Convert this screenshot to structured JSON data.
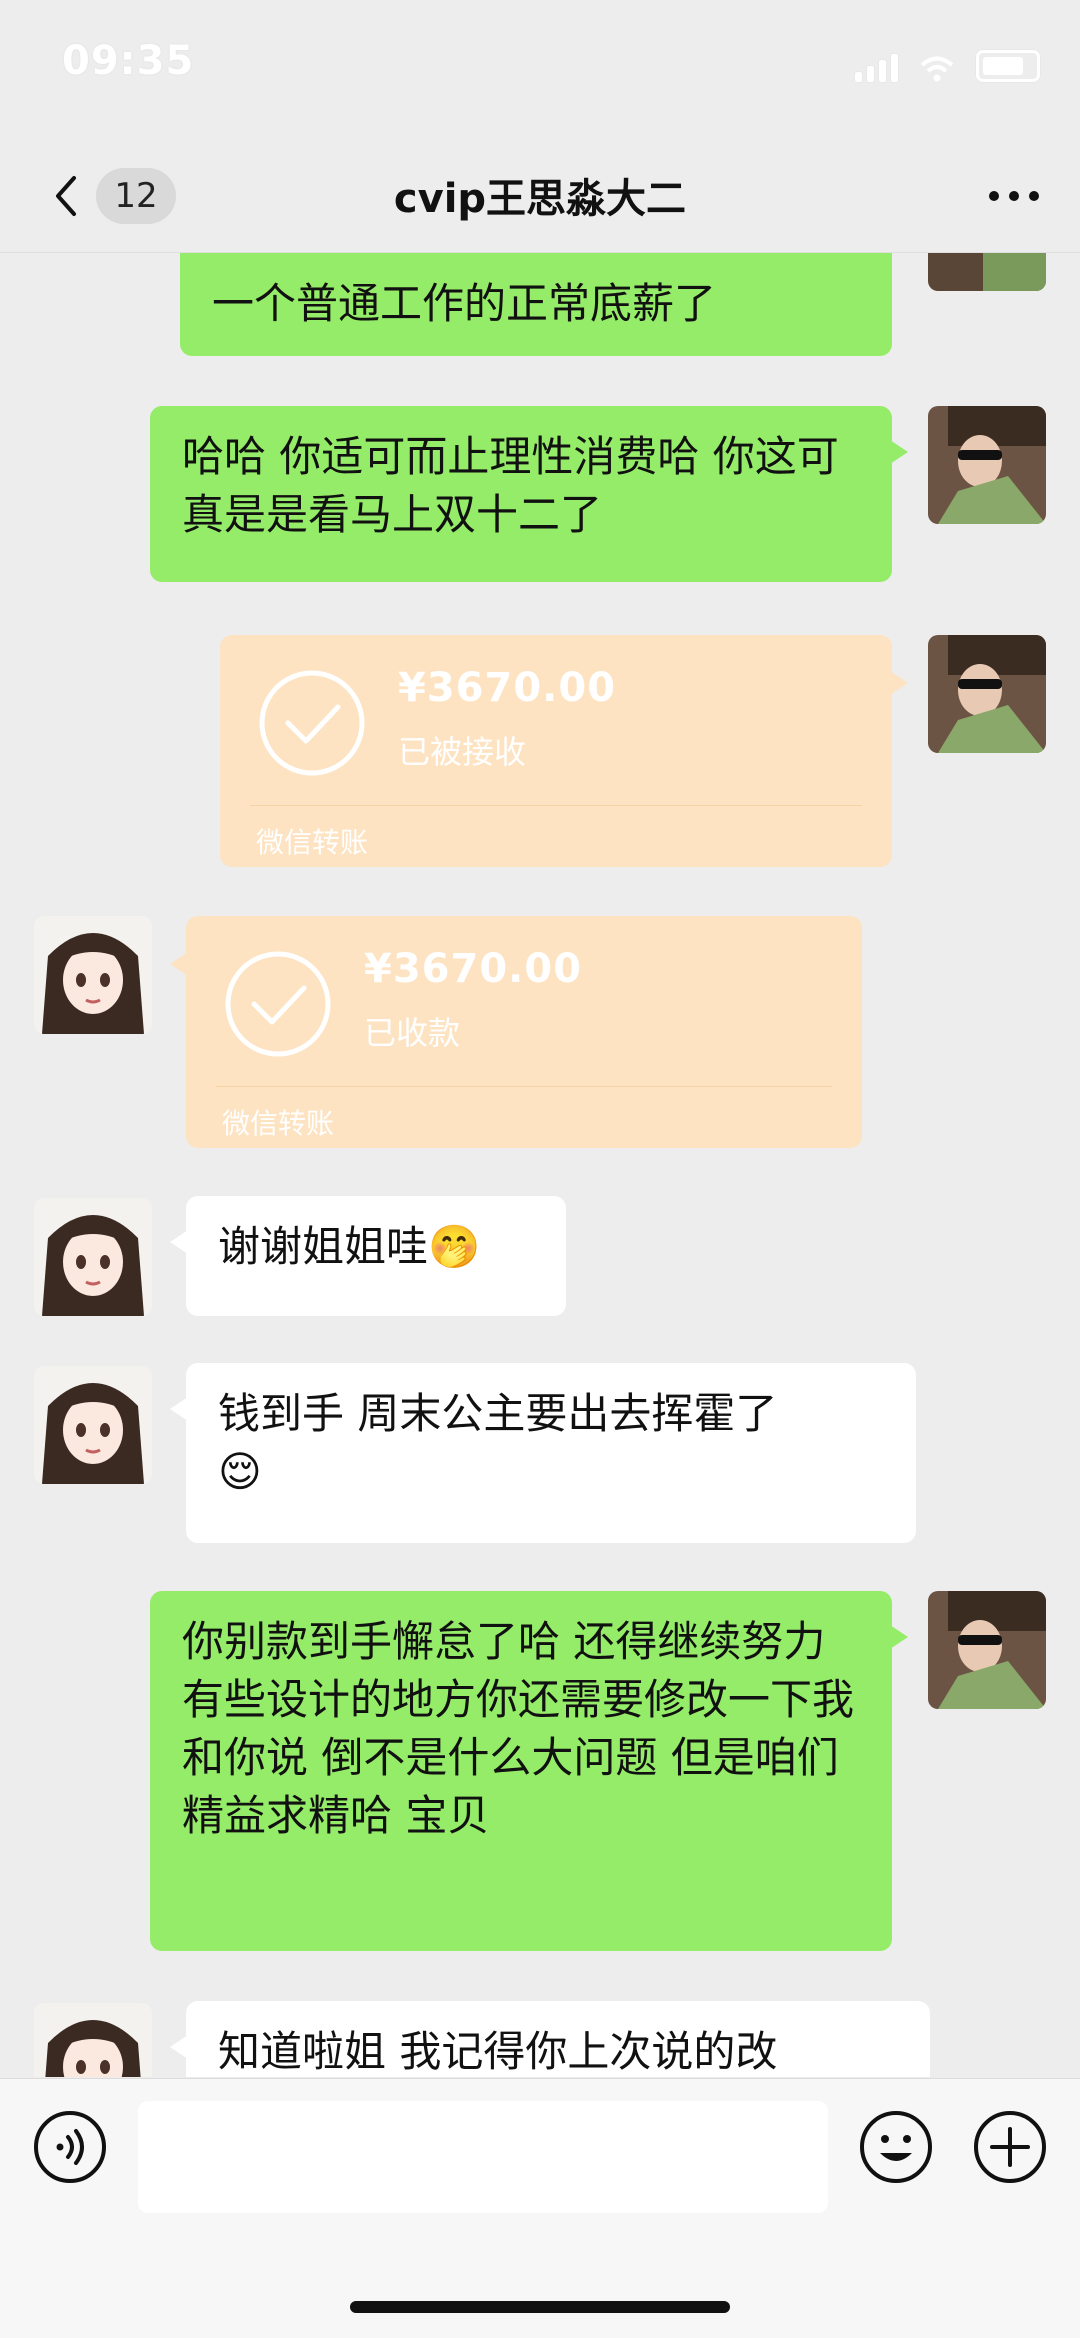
{
  "status_bar": {
    "time": "09:35"
  },
  "header": {
    "unread_count": "12",
    "title": "cvip王思淼大二"
  },
  "messages": {
    "m0": {
      "text": "一个普通工作的正常底薪了"
    },
    "m1": {
      "text": "哈哈 你适可而止理性消费哈 你这可真是是看马上双十二了"
    },
    "m2": {
      "amount": "¥3670.00",
      "status": "已被接收",
      "label": "微信转账"
    },
    "m3": {
      "amount": "¥3670.00",
      "status": "已收款",
      "label": "微信转账"
    },
    "m4": {
      "text": "谢谢姐姐哇",
      "emoji": "🤭"
    },
    "m5": {
      "text": "钱到手 周末公主要出去挥霍了",
      "emoji": "😌"
    },
    "m6": {
      "text": "你别款到手懈怠了哈 还得继续努力 有些设计的地方你还需要修改一下我和你说 倒不是什么大问题 但是咱们精益求精哈 宝贝"
    },
    "m7": {
      "text": "知道啦姐 我记得你上次说的改"
    }
  },
  "input": {
    "placeholder": ""
  },
  "colors": {
    "background": "#ededed",
    "sent_bubble": "#95ec69",
    "received_bubble": "#ffffff",
    "transfer_card": "#fde3c1"
  },
  "icons": [
    "back-icon",
    "more-icon",
    "voice-icon",
    "emoji-icon",
    "plus-icon",
    "check-icon"
  ]
}
